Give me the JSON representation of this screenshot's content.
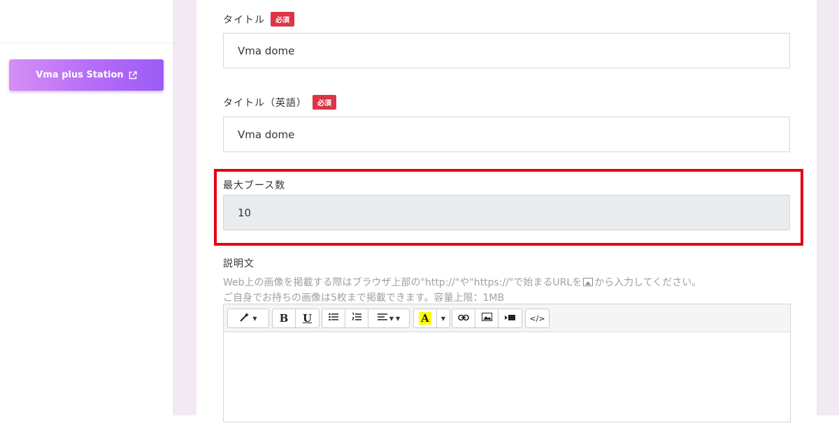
{
  "sidebar": {
    "station_button_label": "Vma plus Station"
  },
  "form": {
    "title": {
      "label": "タイトル",
      "required_badge": "必須",
      "value": "Vma dome"
    },
    "title_en": {
      "label": "タイトル（英語）",
      "required_badge": "必須",
      "value": "Vma dome"
    },
    "max_booths": {
      "label": "最大ブース数",
      "value": "10"
    },
    "description": {
      "label": "説明文",
      "help_line1_before_icon": "Web上の画像を掲載する際はブラウザ上部の\"http://\"や\"https://\"で始まるURLを",
      "help_line1_after_icon": "から入力してください。",
      "help_line2": "ご自身でお持ちの画像は5枚まで掲載できます。容量上限：1MB"
    }
  },
  "editor_toolbar": {
    "bold": "B",
    "underline": "U",
    "font_color": "A",
    "code_view": "</>"
  },
  "colors": {
    "required_badge": "#dc3545",
    "highlight_border": "#e60012",
    "station_gradient_start": "#d58ff6",
    "station_gradient_end": "#9b5cf6",
    "page_gutter": "#f2eaf2"
  }
}
